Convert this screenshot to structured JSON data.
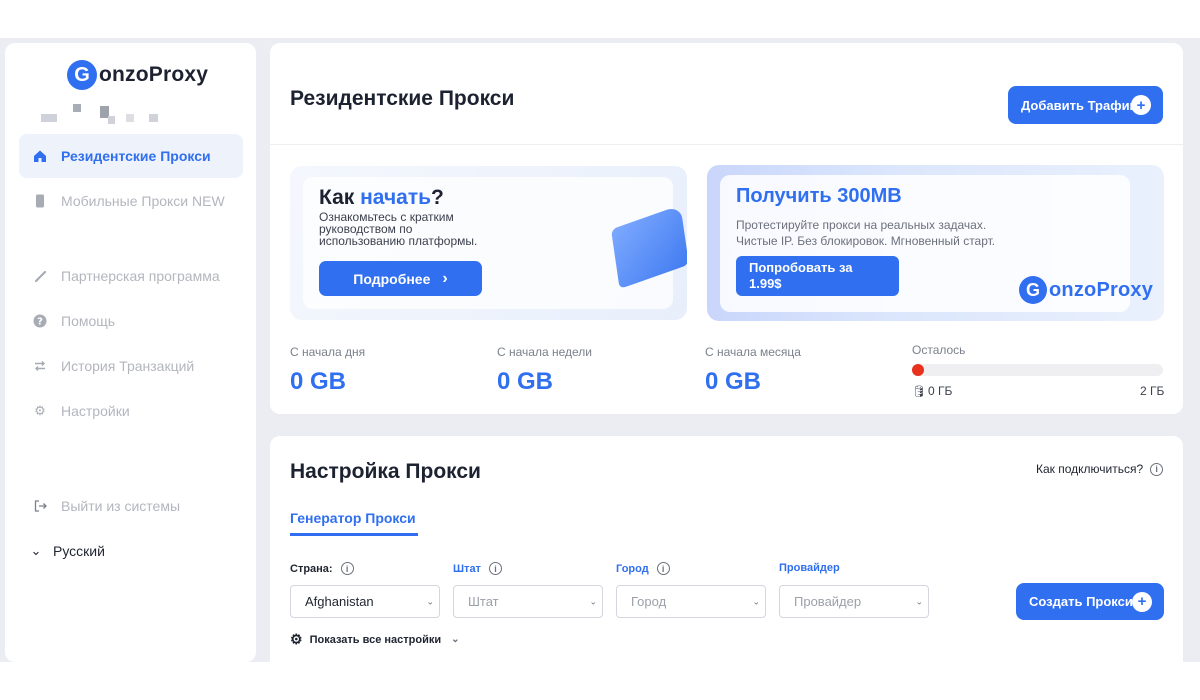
{
  "brand": {
    "logo_letter": "G",
    "logo_text": "onzoProxy",
    "accent_color": "#2f6ff0"
  },
  "sidebar": {
    "items": [
      {
        "label": "Резидентские Прокси",
        "icon": "home-icon",
        "active": true
      },
      {
        "label": "Мобильные Прокси NEW",
        "icon": "mobile-icon",
        "active": false
      },
      {
        "label": "Партнерская программа",
        "icon": "link-icon",
        "active": false
      },
      {
        "label": "Помощь",
        "icon": "help-icon",
        "active": false
      },
      {
        "label": "История Транзакций",
        "icon": "transfer-icon",
        "active": false
      },
      {
        "label": "Настройки",
        "icon": "gear-icon",
        "active": false
      }
    ],
    "logout_label": "Выйти из системы",
    "language_label": "Русский"
  },
  "header": {
    "title": "Резидентские Прокси",
    "add_traffic_label": "Добавить Трафик"
  },
  "banner_start": {
    "title_prefix": "Как ",
    "title_highlight": "начать",
    "title_suffix": "?",
    "description": "Ознакомьтесь с кратким руководством по использованию платформы.",
    "button_label": "Подробнее",
    "button_chevron": "›"
  },
  "banner_trial": {
    "title": "Получить 300MB",
    "line1": "Протестируйте прокси на реальных задачах.",
    "line2": "Чистые IP. Без блокировок. Мгновенный старт.",
    "button_label": "Попробовать за 1.99$",
    "logo_letter": "G",
    "logo_text": "onzoProxy"
  },
  "stats": {
    "day_label": "С начала дня",
    "day_value": "0 GB",
    "week_label": "С начала недели",
    "week_value": "0 GB",
    "month_label": "С начала месяца",
    "month_value": "0 GB",
    "remaining_label": "Осталось",
    "remaining_min": "0 ГБ",
    "remaining_max": "2 ГБ",
    "remaining_fraction": 0.0,
    "progress_color": "#e8321e"
  },
  "proxy_setup": {
    "title": "Настройка Прокси",
    "how_to_connect": "Как подключиться?",
    "tab_label": "Генератор Прокси",
    "country_label": "Страна:",
    "country_value": "Afghanistan",
    "state_label": "Штат",
    "state_placeholder": "Штат",
    "city_label": "Город",
    "city_placeholder": "Город",
    "provider_label": "Провайдер",
    "provider_placeholder": "Провайдер",
    "create_label": "Создать Прокси",
    "show_all_settings": "Показать все настройки"
  }
}
